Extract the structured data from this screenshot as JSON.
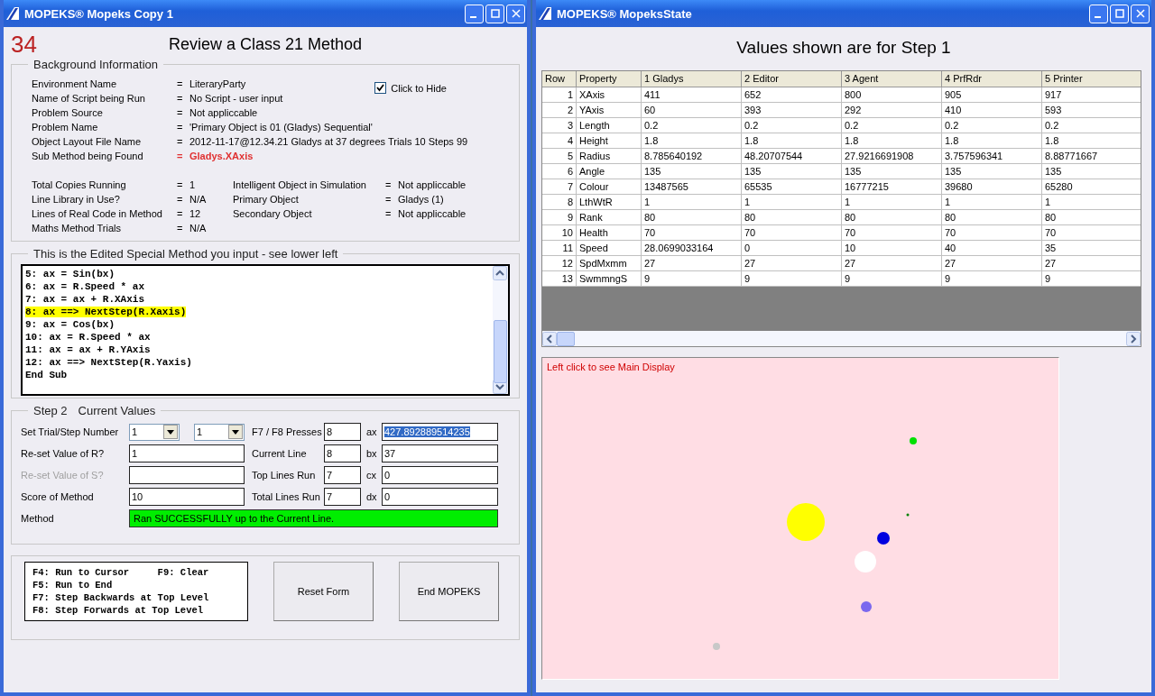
{
  "left_window": {
    "title": "MOPEKS® Mopeks Copy 1",
    "counter": "34",
    "heading": "Review a Class 21 Method",
    "background": {
      "legend": "Background Information",
      "hide": {
        "label": "Click to Hide",
        "checked": true
      },
      "info": [
        {
          "label": "Environment Name",
          "eq": "=",
          "value": "LiteraryParty",
          "highlight": false
        },
        {
          "label": "Name of Script being Run",
          "eq": "=",
          "value": "No Script - user input",
          "highlight": false
        },
        {
          "label": "Problem Source",
          "eq": "=",
          "value": "Not appliccable",
          "highlight": false
        },
        {
          "label": "Problem Name",
          "eq": "=",
          "value": "'Primary Object is 01 (Gladys) Sequential'",
          "highlight": false
        },
        {
          "label": "Object Layout File Name",
          "eq": "=",
          "value": "2012-11-17@12.34.21 Gladys at 37 degrees Trials 10 Steps 99",
          "highlight": false
        },
        {
          "label": "Sub Method being Found",
          "eq": "=",
          "value": "Gladys.XAxis",
          "highlight": true
        }
      ],
      "summary": [
        {
          "label": "Total Copies Running",
          "eq": "=",
          "value": "1",
          "label_2": "Intelligent Object in Simulation",
          "eq_2": "=",
          "value_2": "Not appliccable"
        },
        {
          "label": "Line Library in Use?",
          "eq": "=",
          "value": "N/A",
          "label_2": "Primary Object",
          "eq_2": "=",
          "value_2": "Gladys (1)"
        },
        {
          "label": "Lines of Real Code in Method",
          "eq": "=",
          "value": "12",
          "label_2": "Secondary Object",
          "eq_2": "=",
          "value_2": "Not appliccable"
        },
        {
          "label": "Maths Method Trials",
          "eq": "=",
          "value": "N/A"
        }
      ]
    },
    "method": {
      "legend": "This is the Edited Special Method you input - see lower left",
      "lines": [
        {
          "text": "5: ax = Sin(bx)",
          "current": false
        },
        {
          "text": "6: ax = R.Speed * ax",
          "current": false
        },
        {
          "text": "7: ax = ax + R.XAxis",
          "current": false
        },
        {
          "text": "8: ax ==> NextStep(R.Xaxis)",
          "current": true
        },
        {
          "text": "9: ax = Cos(bx)",
          "current": false
        },
        {
          "text": "10: ax = R.Speed * ax",
          "current": false
        },
        {
          "text": "11: ax = ax + R.YAxis",
          "current": false
        },
        {
          "text": "12: ax ==> NextStep(R.Yaxis)",
          "current": false
        },
        {
          "text": "End Sub",
          "current": false
        }
      ]
    },
    "current_values": {
      "legend": "Step 2",
      "legend_2": "Current Values",
      "trial_label": "Set Trial/Step Number",
      "trial": "1",
      "step": "1",
      "fields": [
        {
          "label": "Re-set Value of R?",
          "value": "1",
          "disabled": false
        },
        {
          "label": "Re-set Value of S?",
          "disabled": true
        },
        {
          "label": "Score of Method",
          "value": "10",
          "disabled": false
        }
      ],
      "counters": [
        {
          "label": "F7 / F8 Presses",
          "value": "8"
        },
        {
          "label": "Current Line",
          "value": "8"
        },
        {
          "label": "Top Lines Run",
          "value": "7"
        },
        {
          "label": "Total Lines Run",
          "value": "7"
        }
      ],
      "registers": [
        {
          "name": "ax",
          "value": "427.892889514235",
          "selected": true
        },
        {
          "name": "bx",
          "value": "37",
          "selected": false
        },
        {
          "name": "cx",
          "value": "0",
          "selected": false
        },
        {
          "name": "dx",
          "value": "0",
          "selected": false
        }
      ],
      "status": {
        "label": "Method",
        "text": "Ran SUCCESSFULLY up to the Current Line.",
        "ok": true
      }
    },
    "keys": [
      "F4: Run to Cursor     F9: Clear",
      "F5: Run to End",
      "F7: Step Backwards at Top Level",
      "F8: Step Forwards at Top Level"
    ],
    "buttons": [
      "Reset Form",
      "End MOPEKS"
    ]
  },
  "right_window": {
    "title": "MOPEKS® MopeksState",
    "heading": "Values shown are for Step 1",
    "table": {
      "columns": [
        "Row",
        "Property",
        "1 Gladys",
        "2 Editor",
        "3 Agent",
        "4 PrfRdr",
        "5 Printer"
      ],
      "rows": [
        [
          "1",
          "XAxis",
          "411",
          "652",
          "800",
          "905",
          "917"
        ],
        [
          "2",
          "YAxis",
          "60",
          "393",
          "292",
          "410",
          "593"
        ],
        [
          "3",
          "Length",
          "0.2",
          "0.2",
          "0.2",
          "0.2",
          "0.2"
        ],
        [
          "4",
          "Height",
          "1.8",
          "1.8",
          "1.8",
          "1.8",
          "1.8"
        ],
        [
          "5",
          "Radius",
          "8.785640192",
          "48.20707544",
          "27.9216691908",
          "3.757596341",
          "8.88771667"
        ],
        [
          "6",
          "Angle",
          "135",
          "135",
          "135",
          "135",
          "135"
        ],
        [
          "7",
          "Colour",
          "13487565",
          "65535",
          "16777215",
          "39680",
          "65280"
        ],
        [
          "8",
          "LthWtR",
          "1",
          "1",
          "1",
          "1",
          "1"
        ],
        [
          "9",
          "Rank",
          "80",
          "80",
          "80",
          "80",
          "80"
        ],
        [
          "10",
          "Health",
          "70",
          "70",
          "70",
          "70",
          "70"
        ],
        [
          "11",
          "Speed",
          "28.0699033164",
          "0",
          "10",
          "40",
          "35"
        ],
        [
          "12",
          "SpdMxmm",
          "27",
          "27",
          "27",
          "27",
          "27"
        ],
        [
          "13",
          "SwmmngS",
          "9",
          "9",
          "9",
          "9",
          "9"
        ]
      ]
    },
    "display": {
      "hint": "Left click to see Main Display"
    }
  }
}
